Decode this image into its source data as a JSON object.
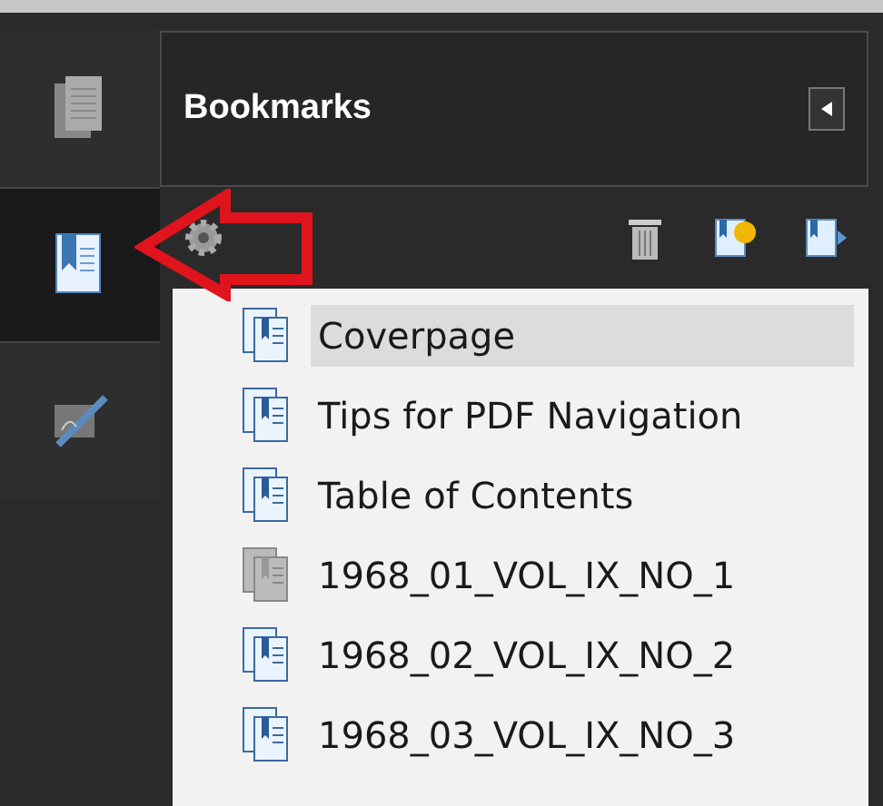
{
  "sidebar": {
    "tabs": [
      {
        "kind": "pages",
        "selected": false
      },
      {
        "kind": "bookmarks",
        "selected": true
      },
      {
        "kind": "signatures",
        "selected": false
      }
    ]
  },
  "panel": {
    "title": "Bookmarks"
  },
  "bookmarks": [
    {
      "label": "Coverpage",
      "selected": true,
      "kind": "bookmark"
    },
    {
      "label": "Tips for PDF Navigation",
      "selected": false,
      "kind": "bookmark"
    },
    {
      "label": "Table of Contents",
      "selected": false,
      "kind": "bookmark"
    },
    {
      "label": "1968_01_VOL_IX_NO_1",
      "selected": false,
      "kind": "grayed"
    },
    {
      "label": "1968_02_VOL_IX_NO_2",
      "selected": false,
      "kind": "bookmark"
    },
    {
      "label": "1968_03_VOL_IX_NO_3",
      "selected": false,
      "kind": "bookmark"
    }
  ]
}
